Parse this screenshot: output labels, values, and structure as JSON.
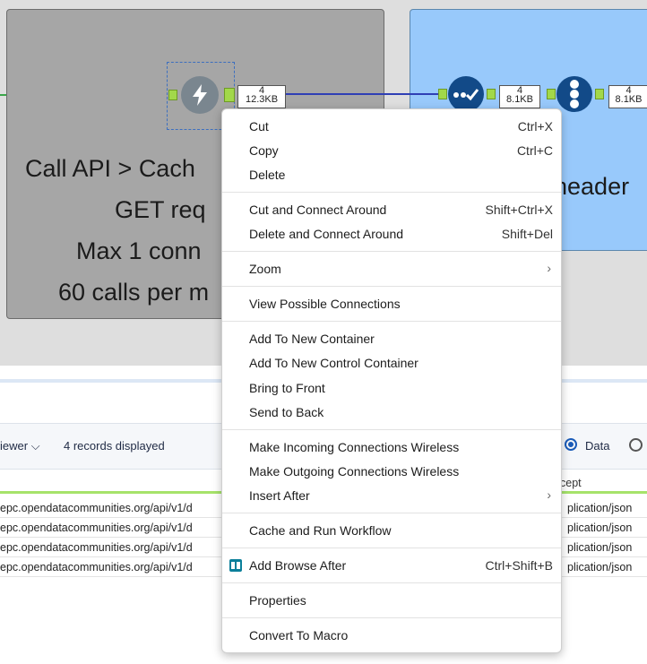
{
  "canvas": {
    "container_left_lines": [
      "Call API > Cach",
      "GET req",
      "Max 1 conn",
      "60 calls per m"
    ],
    "container_right_text": "header",
    "badges": [
      {
        "top": "4",
        "bottom": "12.3KB"
      },
      {
        "top": "4",
        "bottom": "8.1KB"
      },
      {
        "top": "4",
        "bottom": "8.1KB"
      }
    ],
    "colors": {
      "container_grey": "#a6a6a6",
      "container_blue": "#98c9fb",
      "tool_dark_blue": "#124a88",
      "download_tool": "#7a868f"
    }
  },
  "results_panel": {
    "viewer_label": "iewer",
    "records_label": "4 records displayed",
    "radio_data_label": "Data",
    "column_accept_header": "cept",
    "rows": [
      {
        "url": "epc.opendatacommunities.org/api/v1/d",
        "accept": "plication/json"
      },
      {
        "url": "epc.opendatacommunities.org/api/v1/d",
        "accept": "plication/json"
      },
      {
        "url": "epc.opendatacommunities.org/api/v1/d",
        "accept": "plication/json"
      },
      {
        "url": "epc.opendatacommunities.org/api/v1/d",
        "accept": "plication/json"
      }
    ]
  },
  "context_menu": {
    "items": [
      {
        "label": "Cut",
        "shortcut": "Ctrl+X"
      },
      {
        "label": "Copy",
        "shortcut": "Ctrl+C"
      },
      {
        "label": "Delete",
        "shortcut": ""
      },
      {
        "label": "Cut and Connect Around",
        "shortcut": "Shift+Ctrl+X"
      },
      {
        "label": "Delete and Connect Around",
        "shortcut": "Shift+Del"
      },
      {
        "label": "Zoom",
        "shortcut": ""
      },
      {
        "label": "View Possible Connections",
        "shortcut": ""
      },
      {
        "label": "Add To New Container",
        "shortcut": ""
      },
      {
        "label": "Add To New Control Container",
        "shortcut": ""
      },
      {
        "label": "Bring to Front",
        "shortcut": ""
      },
      {
        "label": "Send to Back",
        "shortcut": ""
      },
      {
        "label": "Make Incoming Connections Wireless",
        "shortcut": ""
      },
      {
        "label": "Make Outgoing Connections Wireless",
        "shortcut": ""
      },
      {
        "label": "Insert After",
        "shortcut": ""
      },
      {
        "label": "Cache and Run Workflow",
        "shortcut": ""
      },
      {
        "label": "Add Browse After",
        "shortcut": "Ctrl+Shift+B"
      },
      {
        "label": "Properties",
        "shortcut": ""
      },
      {
        "label": "Convert To Macro",
        "shortcut": ""
      }
    ]
  }
}
